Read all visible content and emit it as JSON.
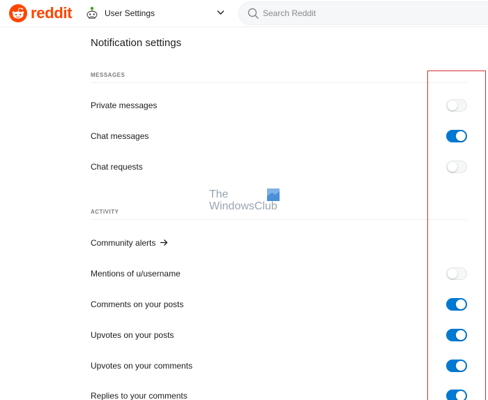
{
  "header": {
    "logo_text": "reddit",
    "context_label": "User Settings",
    "search_placeholder": "Search Reddit"
  },
  "page_title": "Notification settings",
  "sections": [
    {
      "heading": "MESSAGES",
      "items": [
        {
          "label": "Private messages",
          "toggle": false
        },
        {
          "label": "Chat messages",
          "toggle": true
        },
        {
          "label": "Chat requests",
          "toggle": false
        }
      ]
    },
    {
      "heading": "ACTIVITY",
      "items": [
        {
          "label": "Community alerts",
          "link": true
        },
        {
          "label": "Mentions of u/username",
          "toggle": false
        },
        {
          "label": "Comments on your posts",
          "toggle": true
        },
        {
          "label": "Upvotes on your posts",
          "toggle": true
        },
        {
          "label": "Upvotes on your comments",
          "toggle": true
        },
        {
          "label": "Replies to your comments",
          "toggle": true
        }
      ]
    }
  ],
  "watermark": {
    "line1": "The",
    "line2": "WindowsClub"
  },
  "icons": {
    "logo": "reddit-snoo-icon",
    "context": "user-avatar-icon",
    "chevron": "chevron-down-icon",
    "search": "search-icon",
    "link": "arrow-right-icon"
  },
  "colors": {
    "brand": "#ff4500",
    "toggle_on": "#0079d3",
    "toggle_off": "#f6f7f8",
    "highlight": "#d32f2f",
    "text": "#1c1c1c",
    "muted": "#7c7c7c"
  }
}
